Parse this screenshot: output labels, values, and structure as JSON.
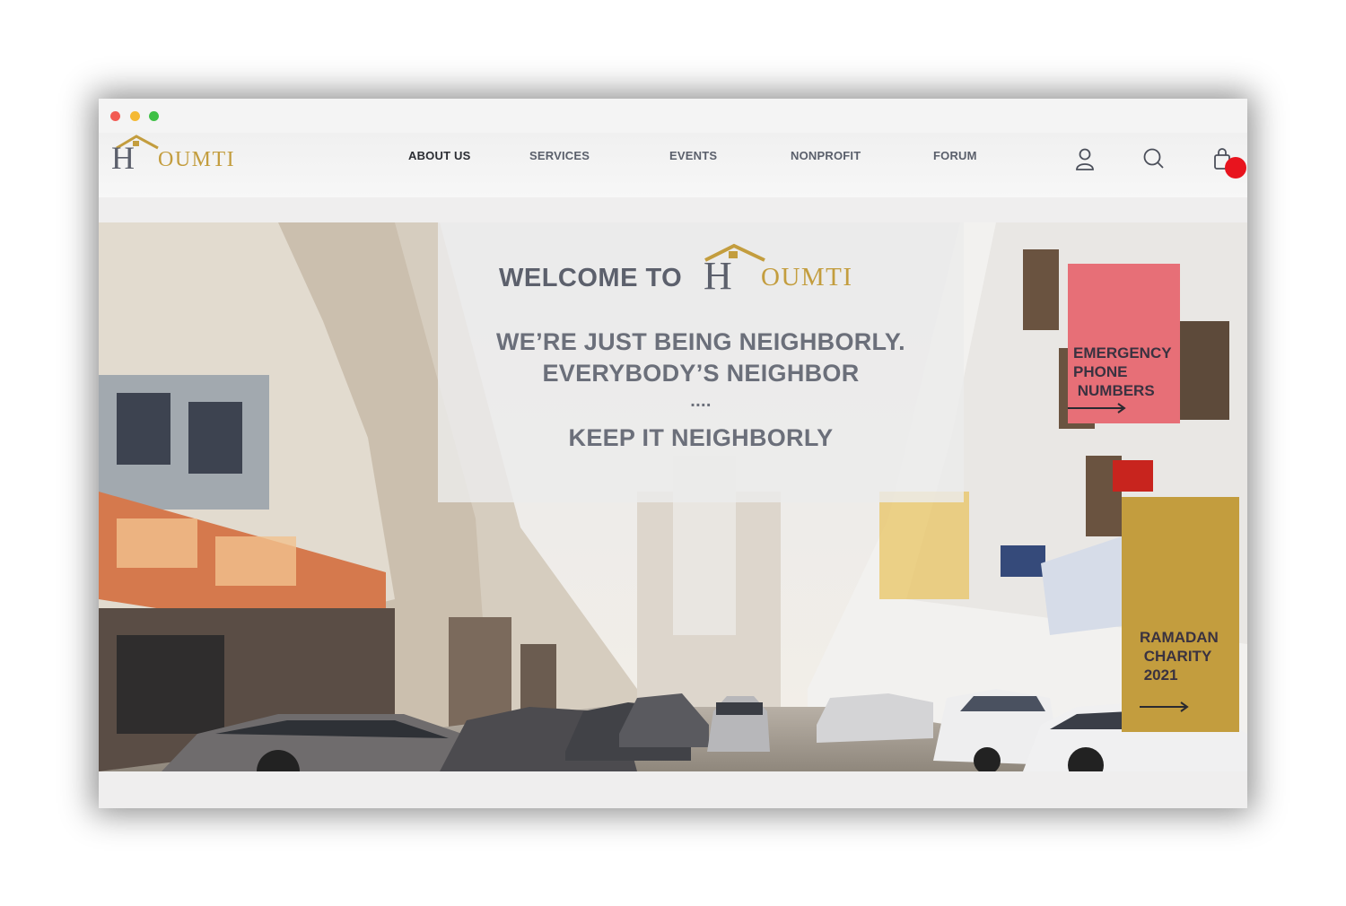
{
  "brand": {
    "logo_initial": "H",
    "logo_rest": "OUMTI",
    "brand_color": "#c39d3e",
    "logo_dark": "#5c606c"
  },
  "nav": {
    "items": [
      {
        "label": "ABOUT US",
        "active": true
      },
      {
        "label": "SERVICES",
        "active": false
      },
      {
        "label": "EVENTS",
        "active": false
      },
      {
        "label": "NONPROFIT",
        "active": false
      },
      {
        "label": "FORUM",
        "active": false
      }
    ],
    "icons": [
      "user-icon",
      "search-icon",
      "shopping-bag-icon"
    ],
    "cart_badge_color": "#e8141e"
  },
  "hero": {
    "welcome_prefix": "WELCOME TO",
    "line1": "WE’RE JUST BEING NEIGHBORLY.",
    "line2": "EVERYBODY’S NEIGHBOR",
    "dots": "....",
    "line3": "KEEP IT NEIGHBORLY",
    "background": "city street with buildings and parked cars"
  },
  "cards": {
    "emergency": {
      "title": "EMERGENCY\nPHONE\n NUMBERS",
      "color": "#e76f77",
      "icon": "arrow-right-icon"
    },
    "ramadan": {
      "title": "RAMADAN\n CHARITY\n 2021",
      "color": "#c39d3e",
      "icon": "arrow-right-icon"
    }
  }
}
